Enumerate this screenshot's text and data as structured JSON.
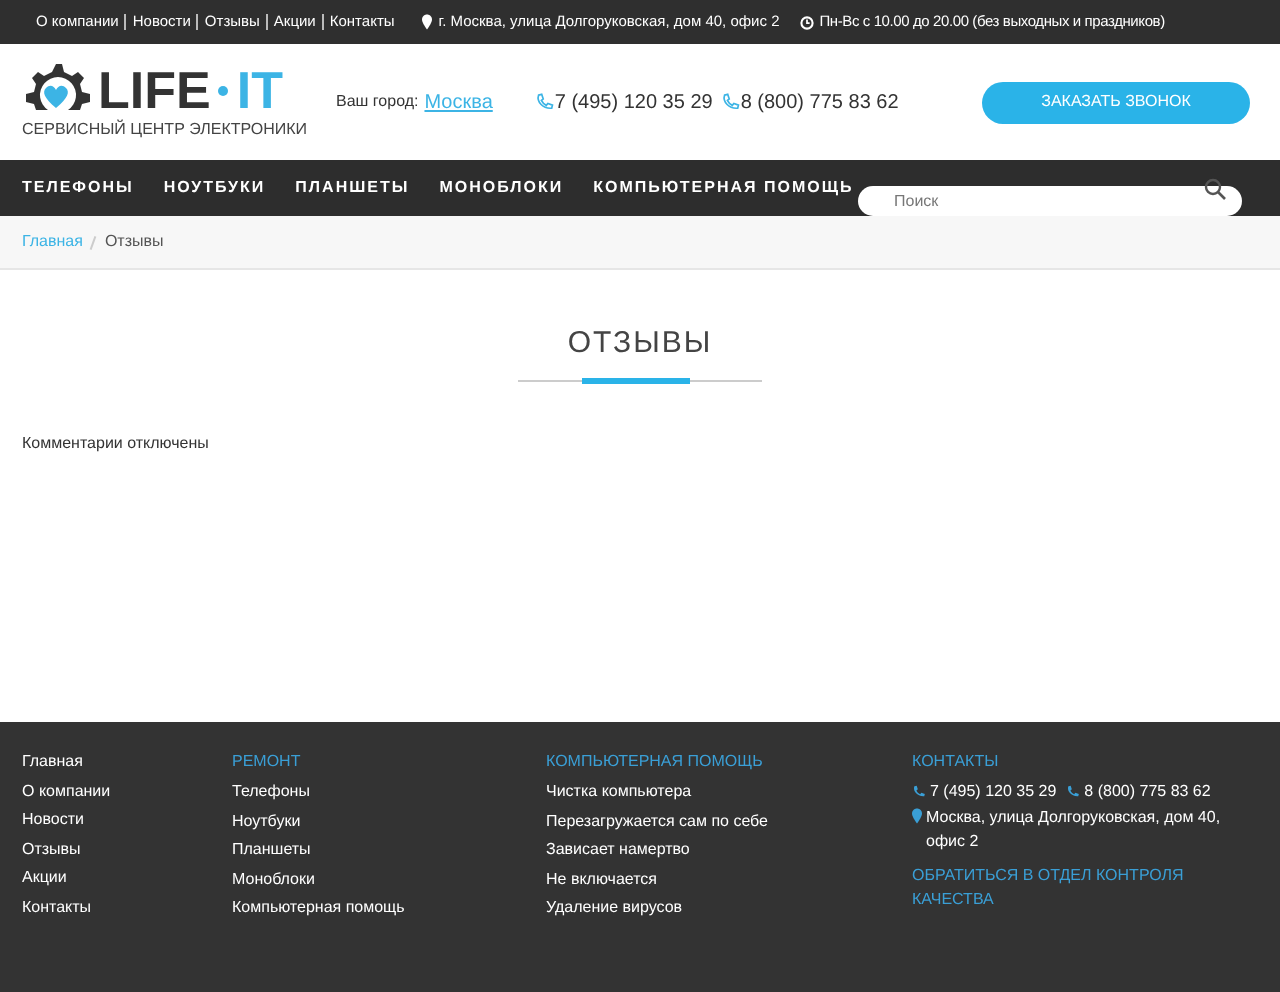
{
  "top_links": [
    "О компании",
    "Новости",
    "Отзывы",
    "Акции",
    "Контакты"
  ],
  "address": "г. Москва, улица Долгоруковская, дом 40, офис 2",
  "hours": "Пн-Вс с 10.00 до 20.00 (без выходных и праздников)",
  "logo": {
    "name_left": "LIFE",
    "name_right": "IT",
    "tagline": "СЕРВИСНЫЙ ЦЕНТР ЭЛЕКТРОНИКИ"
  },
  "city": {
    "label": "Ваш город:",
    "value": "Москва"
  },
  "phones": [
    "7 (495) 120 35 29",
    "8 (800) 775 83 62"
  ],
  "callback_button": "ЗАКАЗАТЬ ЗВОНОК",
  "nav": [
    "ТЕЛЕФОНЫ",
    "НОУТБУКИ",
    "ПЛАНШЕТЫ",
    "МОНОБЛОКИ",
    "КОМПЬЮТЕРНАЯ ПОМОЩЬ"
  ],
  "search": {
    "placeholder": "Поиск"
  },
  "breadcrumb": [
    "Главная",
    "Отзывы"
  ],
  "page_title": "ОТЗЫВЫ",
  "comments_note": "Комментарии отключены",
  "footer": {
    "columns": [
      {
        "links": [
          "Главная",
          "О компании",
          "Новости",
          "Отзывы",
          "Акции",
          "Контакты"
        ]
      },
      {
        "heading": "РЕМОНТ",
        "links": [
          "Телефоны",
          "Ноутбуки",
          "Планшеты",
          "Моноблоки",
          "Компьютерная помощь"
        ]
      },
      {
        "heading": "КОМПЬЮТЕРНАЯ ПОМОЩЬ",
        "links": [
          "Чистка компьютера",
          "Перезагружается сам по себе",
          "Зависает намертво",
          "Не включается",
          "Удаление вирусов"
        ]
      }
    ],
    "contacts": {
      "heading": "КОНТАКТЫ",
      "phones": [
        "7 (495) 120 35 29",
        "8 (800) 775 83 62"
      ],
      "address": "Москва, улица Долгоруковская, дом 40, офис 2",
      "quality_link": "ОБРАТИТЬСЯ В ОТДЕЛ КОНТРОЛЯ КАЧЕСТВА"
    }
  }
}
